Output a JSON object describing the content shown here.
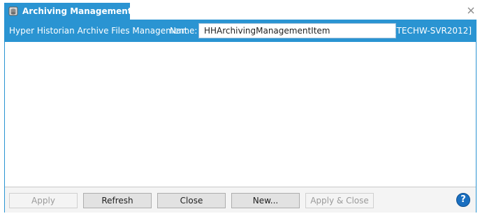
{
  "tab": {
    "title": "Archiving Management",
    "icon": "archive-db-icon",
    "close_icon": "close-icon"
  },
  "header": {
    "title": "Hyper Historian Archive Files Management",
    "name_label": "Name:",
    "name_value": "HHArchivingManagementItem",
    "server": "[TECHW-SVR2012]"
  },
  "footer": {
    "buttons": [
      {
        "label": "Apply",
        "enabled": false
      },
      {
        "label": "Refresh",
        "enabled": true
      },
      {
        "label": "Close",
        "enabled": true
      },
      {
        "label": "New...",
        "enabled": true
      },
      {
        "label": "Apply & Close",
        "enabled": false
      }
    ],
    "help_label": "?"
  },
  "colors": {
    "accent": "#2a94d2",
    "panel_bg": "#ffffff",
    "footer_bg": "#f4f4f4",
    "help": "#1a6fc0"
  }
}
